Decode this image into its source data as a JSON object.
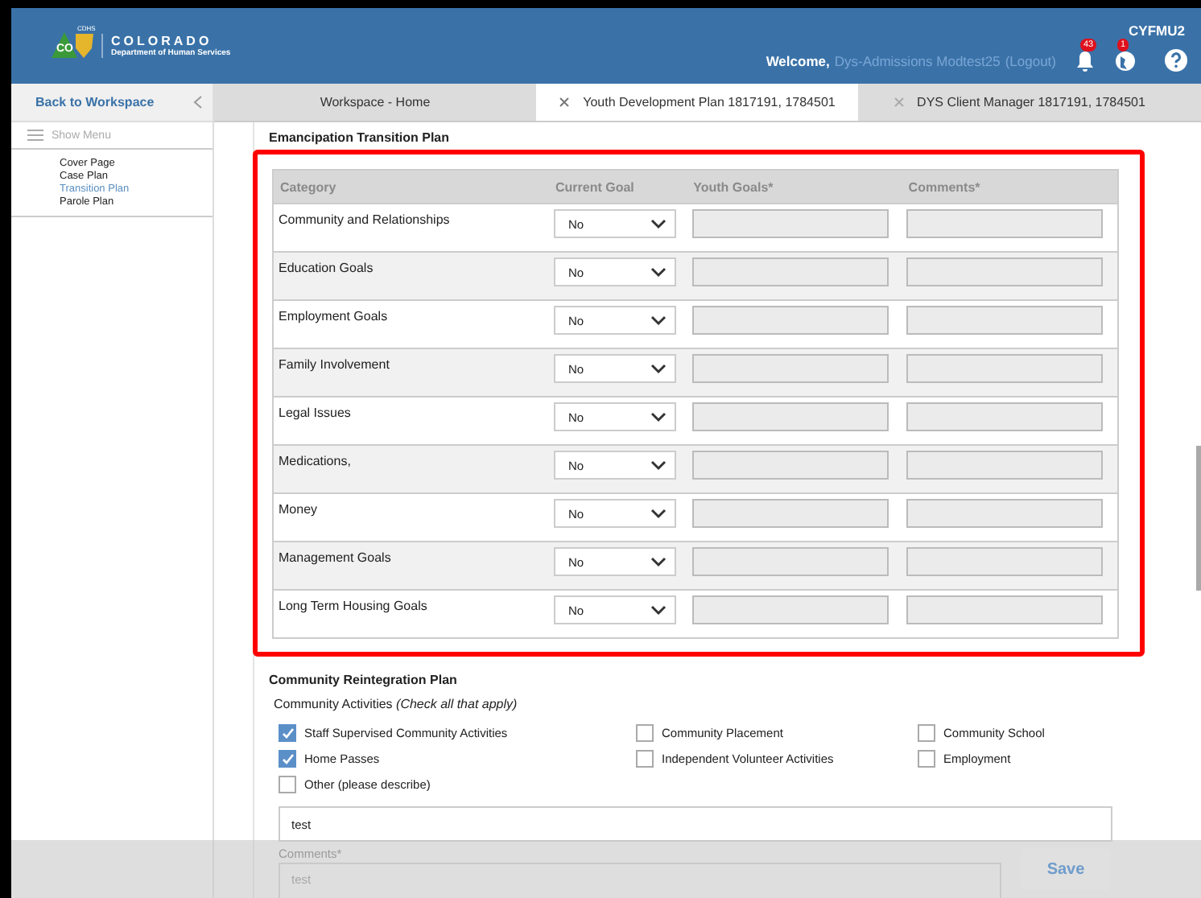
{
  "header": {
    "logo_mark": "CO",
    "logo_badge": "CDHS",
    "org": "COLORADO",
    "dept": "Department of Human Services",
    "welcome": "Welcome,",
    "user_name": "Dys-Admissions Modtest25",
    "logout": "(Logout)",
    "notifications": "43",
    "messages": "1",
    "account": "CYFMU2"
  },
  "sidebar": {
    "back": "Back to Workspace",
    "menu": "Show Menu",
    "items": [
      {
        "label": "Cover Page",
        "selected": false
      },
      {
        "label": "Case Plan",
        "selected": false
      },
      {
        "label": "Transition Plan",
        "selected": true
      },
      {
        "label": "Parole Plan",
        "selected": false
      }
    ]
  },
  "tabs": [
    {
      "label": "Workspace - Home",
      "selected": false,
      "closable": false
    },
    {
      "label": "Youth Development Plan 1817191, 1784501",
      "selected": true,
      "closable": true
    },
    {
      "label": "DYS Client Manager 1817191, 1784501",
      "selected": false,
      "closable": true
    }
  ],
  "emancipation": {
    "title": "Emancipation Transition Plan",
    "columns": [
      "Category",
      "Current Goal",
      "Youth Goals*",
      "Comments*"
    ],
    "rows": [
      {
        "category": "Community and Relationships",
        "current_goal": "No"
      },
      {
        "category": "Education Goals",
        "current_goal": "No"
      },
      {
        "category": "Employment Goals",
        "current_goal": "No"
      },
      {
        "category": "Family Involvement",
        "current_goal": "No"
      },
      {
        "category": "Legal Issues",
        "current_goal": "No"
      },
      {
        "category": "Medications,",
        "current_goal": "No"
      },
      {
        "category": "Money",
        "current_goal": "No"
      },
      {
        "category": "Management Goals",
        "current_goal": "No"
      },
      {
        "category": "Long Term Housing Goals",
        "current_goal": "No"
      }
    ]
  },
  "reintegration": {
    "title": "Community Reintegration Plan",
    "activities_label": "Community Activities *(Check all that apply)*",
    "activities": [
      {
        "label": "Staff Supervised Community Activities",
        "checked": true
      },
      {
        "label": "Community Placement",
        "checked": false
      },
      {
        "label": "Community School",
        "checked": false
      },
      {
        "label": "Home Passes",
        "checked": true
      },
      {
        "label": "Independent Volunteer Activities",
        "checked": false
      },
      {
        "label": "Employment",
        "checked": false
      },
      {
        "label": "Other (please describe)",
        "checked": false
      }
    ],
    "other_value": "test",
    "comments_label": "Comments*",
    "comments_value": "test"
  },
  "save": "Save"
}
